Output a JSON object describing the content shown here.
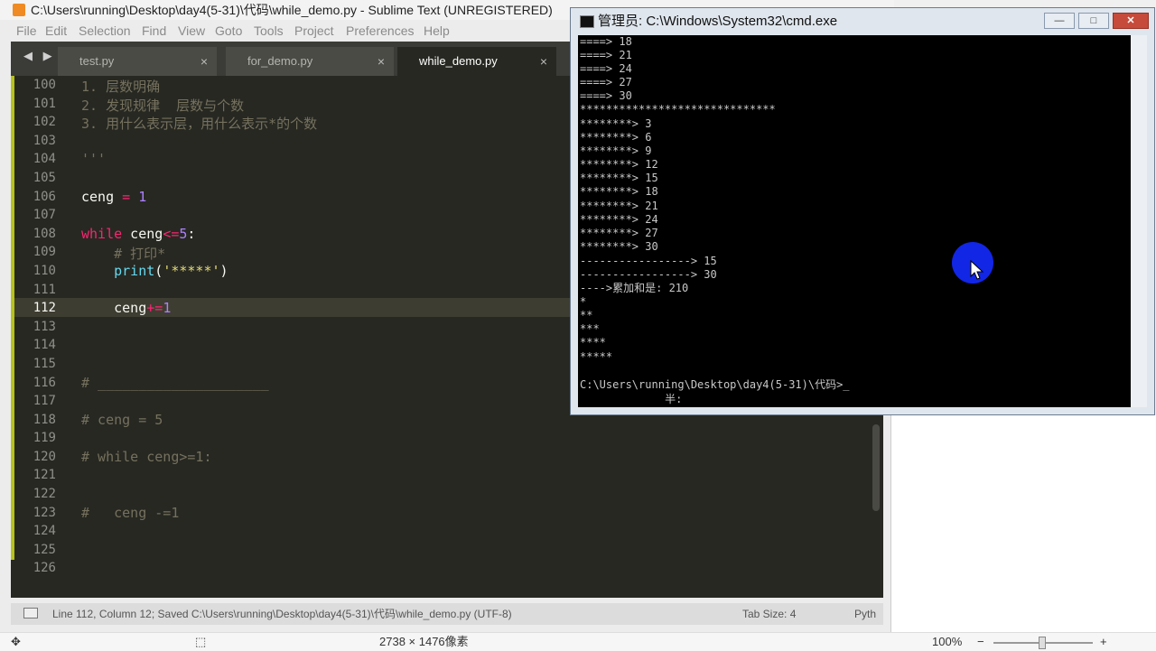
{
  "sublime": {
    "title": "C:\\Users\\running\\Desktop\\day4(5-31)\\代码\\while_demo.py - Sublime Text (UNREGISTERED)",
    "menu": [
      "File",
      "Edit",
      "Selection",
      "Find",
      "View",
      "Goto",
      "Tools",
      "Project",
      "Preferences",
      "Help"
    ],
    "tabs": [
      {
        "label": "test.py",
        "close": "×"
      },
      {
        "label": "for_demo.py",
        "close": "×"
      },
      {
        "label": "while_demo.py",
        "close": "×"
      }
    ],
    "tab_arrows": "◀ ▶",
    "lines": [
      {
        "n": "100",
        "text": "1. 层数明确"
      },
      {
        "n": "101",
        "text": "2. 发现规律  层数与个数"
      },
      {
        "n": "102",
        "text": "3. 用什么表示层，用什么表示*的个数"
      },
      {
        "n": "103",
        "text": ""
      },
      {
        "n": "104",
        "text": "'''"
      },
      {
        "n": "105",
        "text": ""
      },
      {
        "n": "106",
        "text": "ceng = 1"
      },
      {
        "n": "107",
        "text": ""
      },
      {
        "n": "108",
        "text": "while ceng<=5:"
      },
      {
        "n": "109",
        "text": "    # 打印*"
      },
      {
        "n": "110",
        "text": "    print('*****')"
      },
      {
        "n": "111",
        "text": ""
      },
      {
        "n": "112",
        "text": "    ceng+=1"
      },
      {
        "n": "113",
        "text": ""
      },
      {
        "n": "114",
        "text": ""
      },
      {
        "n": "115",
        "text": ""
      },
      {
        "n": "116",
        "text": "# _____________________"
      },
      {
        "n": "117",
        "text": ""
      },
      {
        "n": "118",
        "text": "# ceng = 5"
      },
      {
        "n": "119",
        "text": ""
      },
      {
        "n": "120",
        "text": "# while ceng>=1:"
      },
      {
        "n": "121",
        "text": ""
      },
      {
        "n": "122",
        "text": ""
      },
      {
        "n": "123",
        "text": "#   ceng -=1"
      },
      {
        "n": "124",
        "text": ""
      },
      {
        "n": "125",
        "text": ""
      },
      {
        "n": "126",
        "text": ""
      }
    ],
    "status": {
      "position": "Line 112, Column 12; Saved C:\\Users\\running\\Desktop\\day4(5-31)\\代码\\while_demo.py (UTF-8)",
      "tab_size": "Tab Size: 4",
      "syntax": "Pyth"
    }
  },
  "cmd": {
    "title": "管理员: C:\\Windows\\System32\\cmd.exe",
    "buttons": {
      "minimize": "—",
      "maximize": "□",
      "close": "✕"
    },
    "lines": [
      "====> 18",
      "====> 21",
      "====> 24",
      "====> 27",
      "====> 30",
      "******************************",
      "********> 3",
      "********> 6",
      "********> 9",
      "********> 12",
      "********> 15",
      "********> 18",
      "********> 21",
      "********> 24",
      "********> 27",
      "********> 30",
      "-----------------> 15",
      "-----------------> 30",
      "---->累加和是: 210",
      "*",
      "**",
      "***",
      "****",
      "*****",
      "",
      "C:\\Users\\running\\Desktop\\day4(5-31)\\代码>_",
      "     半:"
    ]
  },
  "viewer": {
    "dimensions": "2738 × 1476像素",
    "zoom": "100%"
  }
}
